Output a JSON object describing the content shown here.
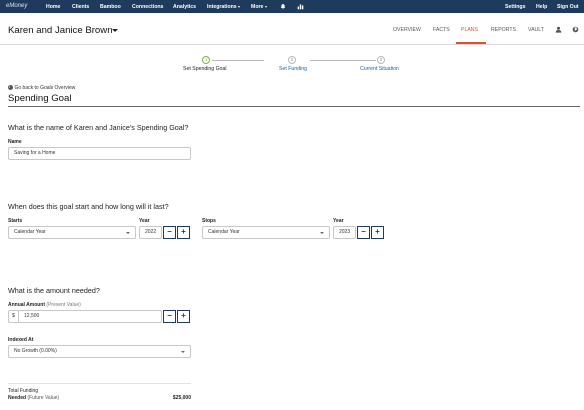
{
  "topnav": {
    "logo": "eMoney",
    "items": [
      "Home",
      "Clients",
      "Bamboo",
      "Connections",
      "Analytics",
      "Integrations",
      "More"
    ],
    "right_items": [
      "Settings",
      "Help",
      "Sign Out"
    ]
  },
  "client": {
    "name": "Karen and Janice Brown",
    "tabs": [
      "OVERVIEW",
      "FACTS",
      "PLANS",
      "REPORTS",
      "VAULT"
    ],
    "active_tab": "PLANS"
  },
  "stepper": {
    "steps": [
      {
        "number": "1",
        "label": "Set Spending Goal"
      },
      {
        "number": "2",
        "label": "Set Funding"
      },
      {
        "number": "3",
        "label": "Current Situation"
      }
    ]
  },
  "page": {
    "back_link": "Go back to Goals Overview",
    "title": "Spending Goal"
  },
  "name_section": {
    "question": "What is the name of Karen and Janice's Spending Goal?",
    "label": "Name",
    "value": "Saving for a Home"
  },
  "timing_section": {
    "question": "When does this goal start and how long will it last?",
    "starts_label": "Starts",
    "starts_value": "Calendar Year",
    "start_year_label": "Year",
    "start_year_value": "2022",
    "stops_label": "Stops",
    "stops_value": "Calendar Year",
    "stop_year_label": "Year",
    "stop_year_value": "2023",
    "minus": "−",
    "plus": "+"
  },
  "amount_section": {
    "question": "What is the amount needed?",
    "annual_label": "Annual Amount",
    "annual_sub": "(Present Value)",
    "currency": "$",
    "annual_value": "12,500",
    "indexed_label": "Indexed At",
    "indexed_value": "No Growth (0.00%)"
  },
  "totals": {
    "total_label": "Total Funding",
    "needed_label": "Needed",
    "needed_sub": "(Future Value)",
    "needed_value": "$25,000"
  },
  "colors": {
    "nav_bg": "#1e3a5c",
    "accent": "#e0502d",
    "link": "#1a5ea8",
    "step_active": "#7cb342"
  }
}
